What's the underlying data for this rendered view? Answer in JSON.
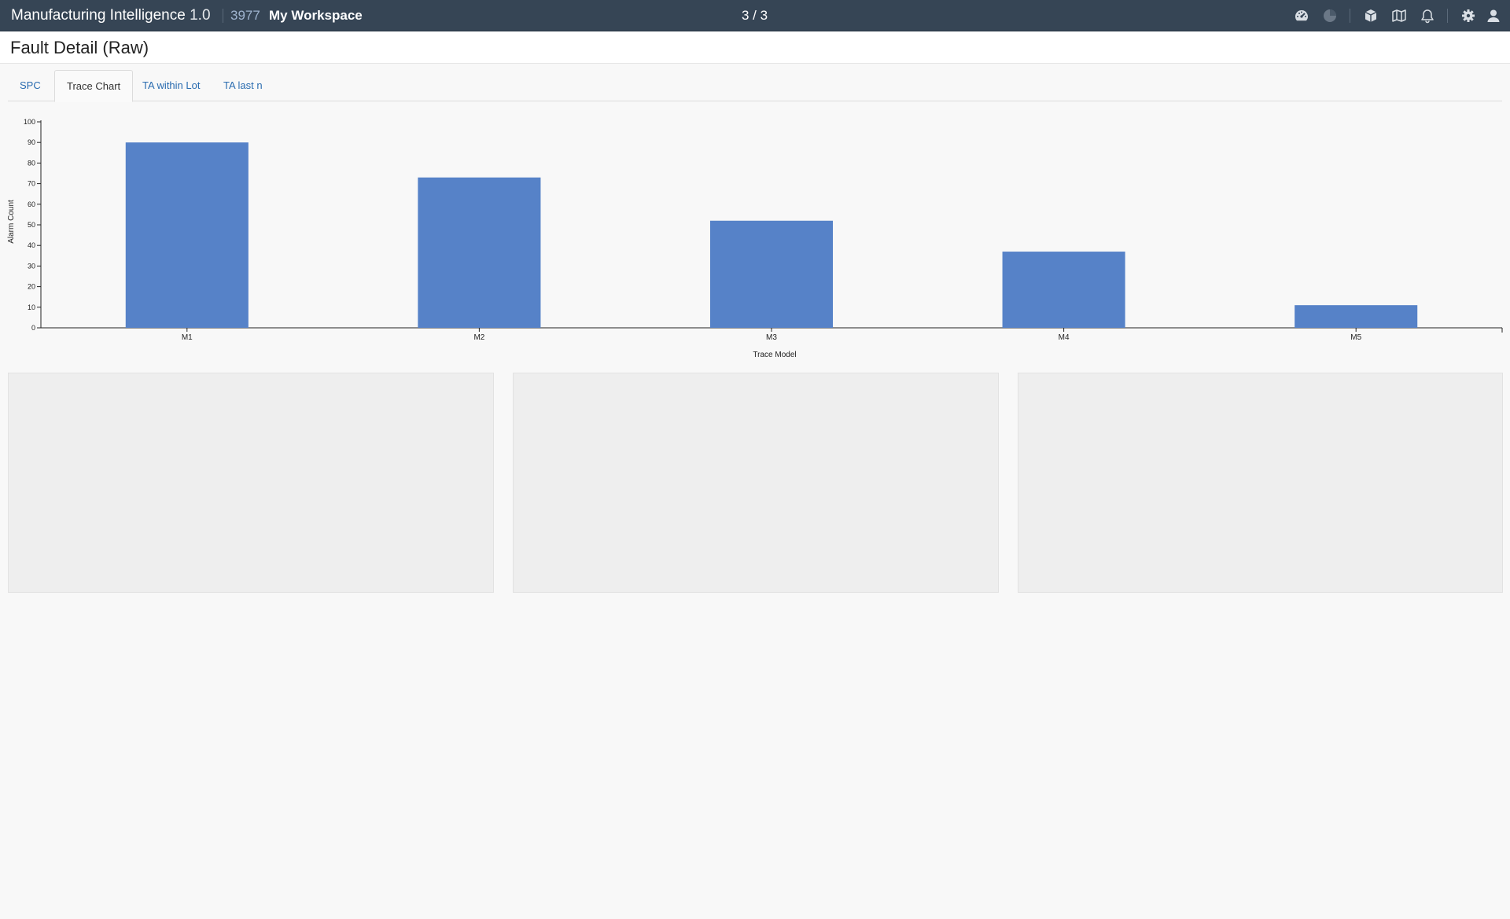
{
  "header": {
    "app_name": "Manufacturing Intelligence",
    "app_version": "1.0",
    "workspace_id": "3977",
    "workspace_name": "My Workspace",
    "pager": "3 / 3"
  },
  "toolbar_icons": [
    "dashboard-icon",
    "pie-chart-icon",
    "cube-icon",
    "map-icon",
    "bell-icon",
    "gear-icon",
    "user-icon"
  ],
  "page": {
    "title": "Fault Detail (Raw)"
  },
  "tabs": [
    {
      "label": "SPC",
      "active": false
    },
    {
      "label": "Trace Chart",
      "active": true
    },
    {
      "label": "TA within Lot",
      "active": false
    },
    {
      "label": "TA last n",
      "active": false
    }
  ],
  "colors": {
    "topbar": "#364555",
    "bar": "#5682c8",
    "tab_link": "#2a6cb0"
  },
  "chart_data": {
    "type": "bar",
    "categories": [
      "M1",
      "M2",
      "M3",
      "M4",
      "M5"
    ],
    "values": [
      90,
      73,
      52,
      37,
      11
    ],
    "xlabel": "Trace Model",
    "ylabel": "Alarm Count",
    "ylim": [
      0,
      100
    ],
    "yticks": [
      0,
      10,
      20,
      30,
      40,
      50,
      60,
      70,
      80,
      90,
      100
    ],
    "grid": false,
    "legend": "none"
  }
}
